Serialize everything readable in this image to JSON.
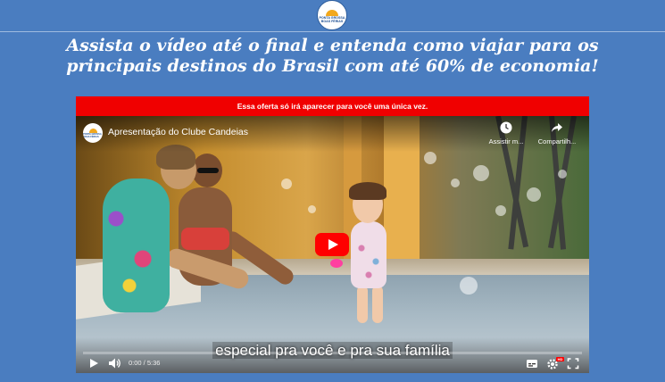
{
  "header": {
    "logo_text": "PONTA GROSSA\nBOAS FÉRIAS",
    "headline": "Assista o vídeo até o final e entenda como viajar para os principais destinos do Brasil com até 60% de economia!"
  },
  "offer_bar": {
    "text": "Essa oferta só irá aparecer para você uma única vez."
  },
  "video": {
    "title": "Apresentação do Clube Candeias",
    "watch_later_label": "Assistir m...",
    "share_label": "Compartilh...",
    "subtitle": "especial pra você e pra sua família",
    "time_display": "0:00 / 5:36",
    "progress": 0,
    "quality_badge": "HD",
    "icons": [
      "play-icon",
      "volume-icon",
      "captions-icon",
      "settings-icon",
      "fullscreen-icon",
      "clock-icon",
      "share-icon",
      "youtube-play-icon"
    ]
  },
  "colors": {
    "page_bg": "#4a7dc0",
    "offer_bar": "#f00000",
    "play_button": "#ff0000"
  }
}
